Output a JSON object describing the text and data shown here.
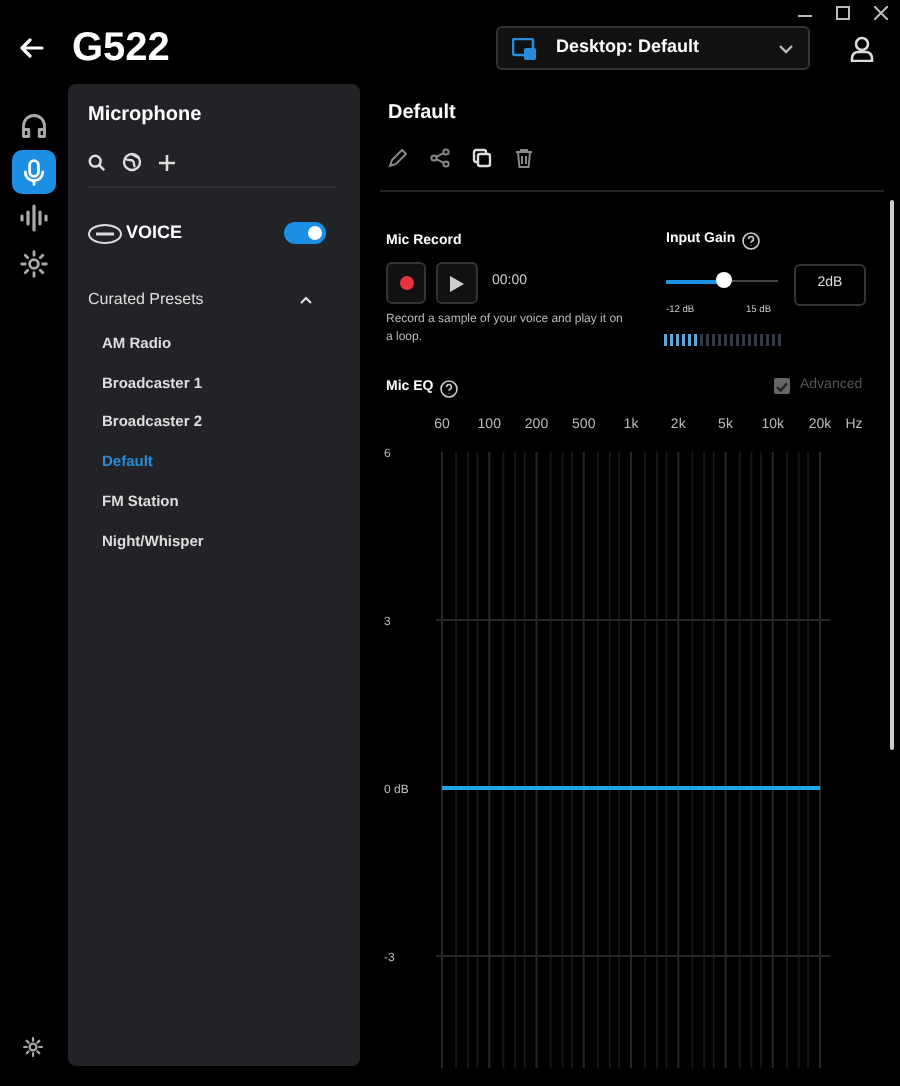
{
  "window": {
    "title": "G522"
  },
  "profile_dropdown": {
    "value": "Desktop: Default"
  },
  "rail": [
    {
      "kind": "headphones",
      "selected": false
    },
    {
      "kind": "mic",
      "selected": true
    },
    {
      "kind": "wave",
      "selected": false
    },
    {
      "kind": "light",
      "selected": false
    }
  ],
  "sidebar": {
    "title": "Microphone",
    "voice_label": "VOICE",
    "voice_on": true,
    "section": "Curated Presets",
    "expanded": true,
    "items": [
      {
        "label": "AM Radio",
        "selected": false
      },
      {
        "label": "Broadcaster 1",
        "selected": false
      },
      {
        "label": "Broadcaster 2",
        "selected": false
      },
      {
        "label": "Default",
        "selected": true
      },
      {
        "label": "FM Station",
        "selected": false
      },
      {
        "label": "Night/Whisper",
        "selected": false
      }
    ]
  },
  "preset": {
    "title": "Default"
  },
  "mic_record": {
    "title": "Mic Record",
    "time": "00:00",
    "description": "Record a sample of your voice and play it on a loop."
  },
  "input_gain": {
    "title": "Input Gain",
    "level": 0.51,
    "min_label": "-12 dB",
    "max_label": "15 dB",
    "value": "2dB"
  },
  "input_meter": {
    "level": 0.3
  },
  "mic_eq": {
    "title": "Mic EQ",
    "advanced_label": "Advanced",
    "advanced_checked": true,
    "advanced_disabled": true,
    "chart_data": {
      "type": "line",
      "xlabel": "Hz",
      "grid": true,
      "ylim": [
        -5,
        6
      ],
      "categories": [
        "60",
        "100",
        "200",
        "500",
        "1k",
        "2k",
        "5k",
        "10k",
        "20k"
      ],
      "yticks": [
        6,
        3,
        {
          "value": 0,
          "label": "0 dB"
        },
        -3
      ],
      "series": [
        {
          "color": "#1ea7e8",
          "values": [
            0,
            0,
            0,
            0,
            0,
            0,
            0,
            0,
            0
          ]
        }
      ]
    }
  }
}
